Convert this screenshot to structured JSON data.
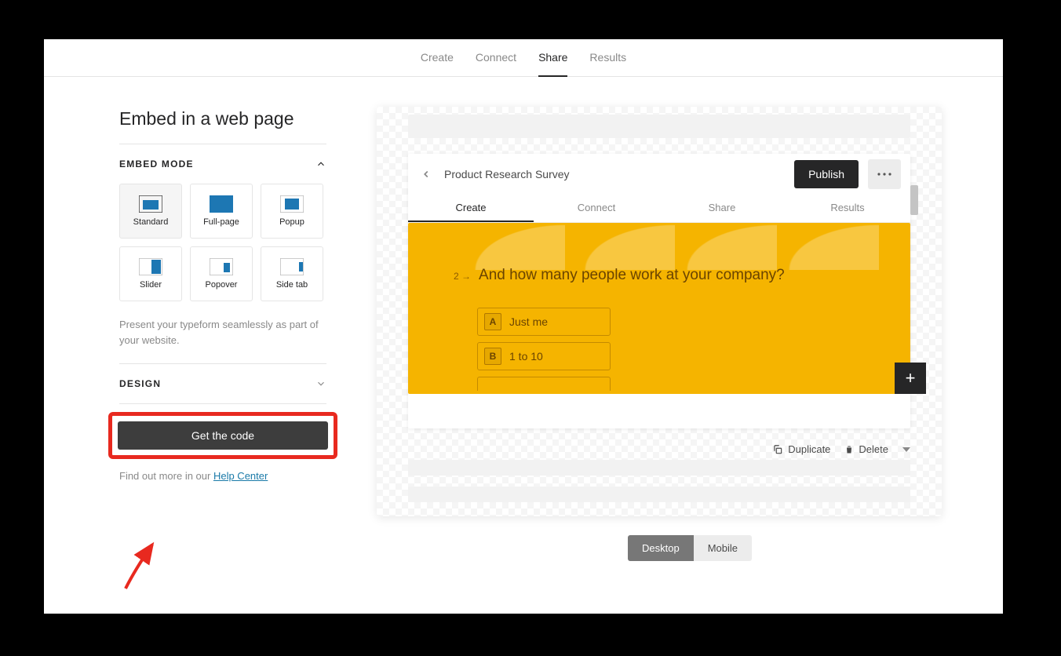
{
  "top_tabs": {
    "create": "Create",
    "connect": "Connect",
    "share": "Share",
    "results": "Results"
  },
  "panel": {
    "title": "Embed in a web page",
    "embed_mode_label": "EMBED MODE",
    "modes": {
      "standard": "Standard",
      "fullpage": "Full-page",
      "popup": "Popup",
      "slider": "Slider",
      "popover": "Popover",
      "sidetab": "Side tab"
    },
    "description": "Present your typeform seamlessly as part of your website.",
    "design_label": "DESIGN",
    "get_code": "Get the code",
    "help_prefix": "Find out more in our ",
    "help_link": "Help Center"
  },
  "preview": {
    "form_title": "Product Research Survey",
    "publish": "Publish",
    "tabs": {
      "create": "Create",
      "connect": "Connect",
      "share": "Share",
      "results": "Results"
    },
    "question_num": "2 →",
    "question_text": "And how many people work at your company?",
    "option_a_key": "A",
    "option_a_label": "Just me",
    "option_b_key": "B",
    "option_b_label": "1 to 10",
    "duplicate": "Duplicate",
    "delete": "Delete",
    "view_desktop": "Desktop",
    "view_mobile": "Mobile"
  }
}
